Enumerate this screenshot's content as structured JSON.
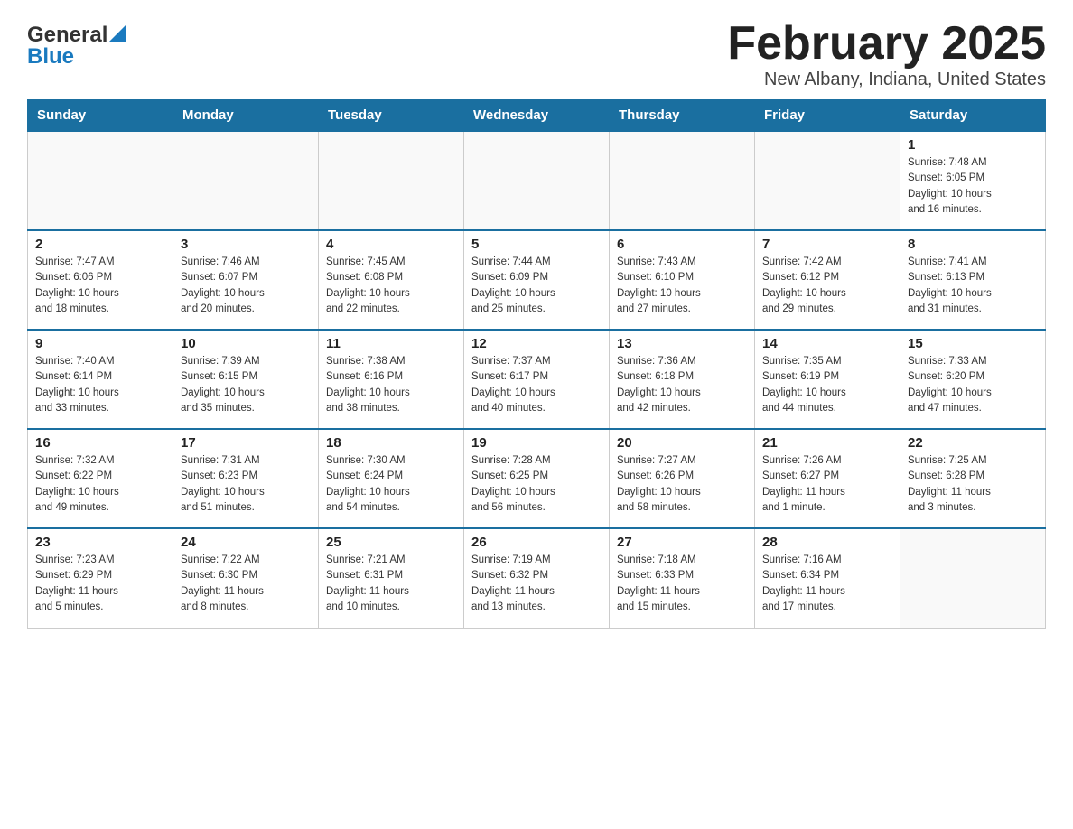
{
  "logo": {
    "line1": "General",
    "line2": "Blue",
    "arrow": "▲"
  },
  "title": "February 2025",
  "subtitle": "New Albany, Indiana, United States",
  "weekdays": [
    "Sunday",
    "Monday",
    "Tuesday",
    "Wednesday",
    "Thursday",
    "Friday",
    "Saturday"
  ],
  "weeks": [
    [
      {
        "day": "",
        "info": ""
      },
      {
        "day": "",
        "info": ""
      },
      {
        "day": "",
        "info": ""
      },
      {
        "day": "",
        "info": ""
      },
      {
        "day": "",
        "info": ""
      },
      {
        "day": "",
        "info": ""
      },
      {
        "day": "1",
        "info": "Sunrise: 7:48 AM\nSunset: 6:05 PM\nDaylight: 10 hours\nand 16 minutes."
      }
    ],
    [
      {
        "day": "2",
        "info": "Sunrise: 7:47 AM\nSunset: 6:06 PM\nDaylight: 10 hours\nand 18 minutes."
      },
      {
        "day": "3",
        "info": "Sunrise: 7:46 AM\nSunset: 6:07 PM\nDaylight: 10 hours\nand 20 minutes."
      },
      {
        "day": "4",
        "info": "Sunrise: 7:45 AM\nSunset: 6:08 PM\nDaylight: 10 hours\nand 22 minutes."
      },
      {
        "day": "5",
        "info": "Sunrise: 7:44 AM\nSunset: 6:09 PM\nDaylight: 10 hours\nand 25 minutes."
      },
      {
        "day": "6",
        "info": "Sunrise: 7:43 AM\nSunset: 6:10 PM\nDaylight: 10 hours\nand 27 minutes."
      },
      {
        "day": "7",
        "info": "Sunrise: 7:42 AM\nSunset: 6:12 PM\nDaylight: 10 hours\nand 29 minutes."
      },
      {
        "day": "8",
        "info": "Sunrise: 7:41 AM\nSunset: 6:13 PM\nDaylight: 10 hours\nand 31 minutes."
      }
    ],
    [
      {
        "day": "9",
        "info": "Sunrise: 7:40 AM\nSunset: 6:14 PM\nDaylight: 10 hours\nand 33 minutes."
      },
      {
        "day": "10",
        "info": "Sunrise: 7:39 AM\nSunset: 6:15 PM\nDaylight: 10 hours\nand 35 minutes."
      },
      {
        "day": "11",
        "info": "Sunrise: 7:38 AM\nSunset: 6:16 PM\nDaylight: 10 hours\nand 38 minutes."
      },
      {
        "day": "12",
        "info": "Sunrise: 7:37 AM\nSunset: 6:17 PM\nDaylight: 10 hours\nand 40 minutes."
      },
      {
        "day": "13",
        "info": "Sunrise: 7:36 AM\nSunset: 6:18 PM\nDaylight: 10 hours\nand 42 minutes."
      },
      {
        "day": "14",
        "info": "Sunrise: 7:35 AM\nSunset: 6:19 PM\nDaylight: 10 hours\nand 44 minutes."
      },
      {
        "day": "15",
        "info": "Sunrise: 7:33 AM\nSunset: 6:20 PM\nDaylight: 10 hours\nand 47 minutes."
      }
    ],
    [
      {
        "day": "16",
        "info": "Sunrise: 7:32 AM\nSunset: 6:22 PM\nDaylight: 10 hours\nand 49 minutes."
      },
      {
        "day": "17",
        "info": "Sunrise: 7:31 AM\nSunset: 6:23 PM\nDaylight: 10 hours\nand 51 minutes."
      },
      {
        "day": "18",
        "info": "Sunrise: 7:30 AM\nSunset: 6:24 PM\nDaylight: 10 hours\nand 54 minutes."
      },
      {
        "day": "19",
        "info": "Sunrise: 7:28 AM\nSunset: 6:25 PM\nDaylight: 10 hours\nand 56 minutes."
      },
      {
        "day": "20",
        "info": "Sunrise: 7:27 AM\nSunset: 6:26 PM\nDaylight: 10 hours\nand 58 minutes."
      },
      {
        "day": "21",
        "info": "Sunrise: 7:26 AM\nSunset: 6:27 PM\nDaylight: 11 hours\nand 1 minute."
      },
      {
        "day": "22",
        "info": "Sunrise: 7:25 AM\nSunset: 6:28 PM\nDaylight: 11 hours\nand 3 minutes."
      }
    ],
    [
      {
        "day": "23",
        "info": "Sunrise: 7:23 AM\nSunset: 6:29 PM\nDaylight: 11 hours\nand 5 minutes."
      },
      {
        "day": "24",
        "info": "Sunrise: 7:22 AM\nSunset: 6:30 PM\nDaylight: 11 hours\nand 8 minutes."
      },
      {
        "day": "25",
        "info": "Sunrise: 7:21 AM\nSunset: 6:31 PM\nDaylight: 11 hours\nand 10 minutes."
      },
      {
        "day": "26",
        "info": "Sunrise: 7:19 AM\nSunset: 6:32 PM\nDaylight: 11 hours\nand 13 minutes."
      },
      {
        "day": "27",
        "info": "Sunrise: 7:18 AM\nSunset: 6:33 PM\nDaylight: 11 hours\nand 15 minutes."
      },
      {
        "day": "28",
        "info": "Sunrise: 7:16 AM\nSunset: 6:34 PM\nDaylight: 11 hours\nand 17 minutes."
      },
      {
        "day": "",
        "info": ""
      }
    ]
  ]
}
